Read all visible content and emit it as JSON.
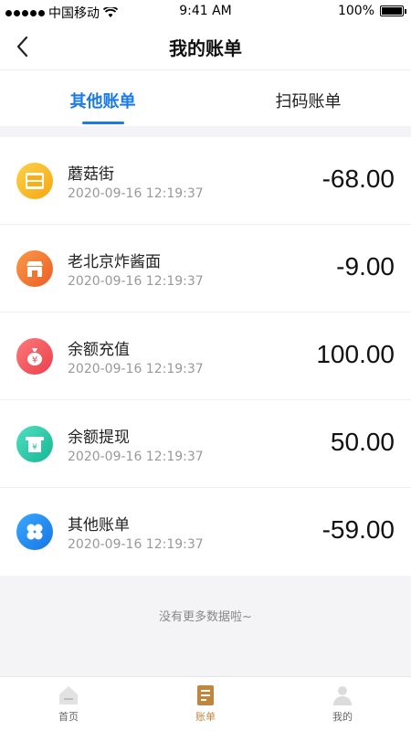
{
  "status_bar": {
    "carrier": "中国移动",
    "time": "9:41 AM",
    "battery": "100%"
  },
  "nav": {
    "title": "我的账单"
  },
  "tabs": [
    {
      "label": "其他账单",
      "active": true
    },
    {
      "label": "扫码账单",
      "active": false
    }
  ],
  "bills": [
    {
      "name": "蘑菇街",
      "time": "2020-09-16 12:19:37",
      "amount": "-68.00",
      "icon": "card-icon",
      "color": "#f7b51d"
    },
    {
      "name": "老北京炸酱面",
      "time": "2020-09-16 12:19:37",
      "amount": "-9.00",
      "icon": "store-icon",
      "color": "#f2762e"
    },
    {
      "name": "余额充值",
      "time": "2020-09-16 12:19:37",
      "amount": "100.00",
      "icon": "money-bag-icon",
      "color": "#f05a5a"
    },
    {
      "name": "余额提现",
      "time": "2020-09-16 12:19:37",
      "amount": "50.00",
      "icon": "withdraw-icon",
      "color": "#2ec9a8"
    },
    {
      "name": "其他账单",
      "time": "2020-09-16 12:19:37",
      "amount": "-59.00",
      "icon": "clover-icon",
      "color": "#1f8ef0"
    }
  ],
  "footer_note": "没有更多数据啦~",
  "tabbar": [
    {
      "label": "首页",
      "icon": "home-icon",
      "active": false
    },
    {
      "label": "账单",
      "icon": "bill-icon",
      "active": true
    },
    {
      "label": "我的",
      "icon": "user-icon",
      "active": false
    }
  ],
  "colors": {
    "accent": "#1a7ae8",
    "tabbar_active": "#c0863e"
  }
}
